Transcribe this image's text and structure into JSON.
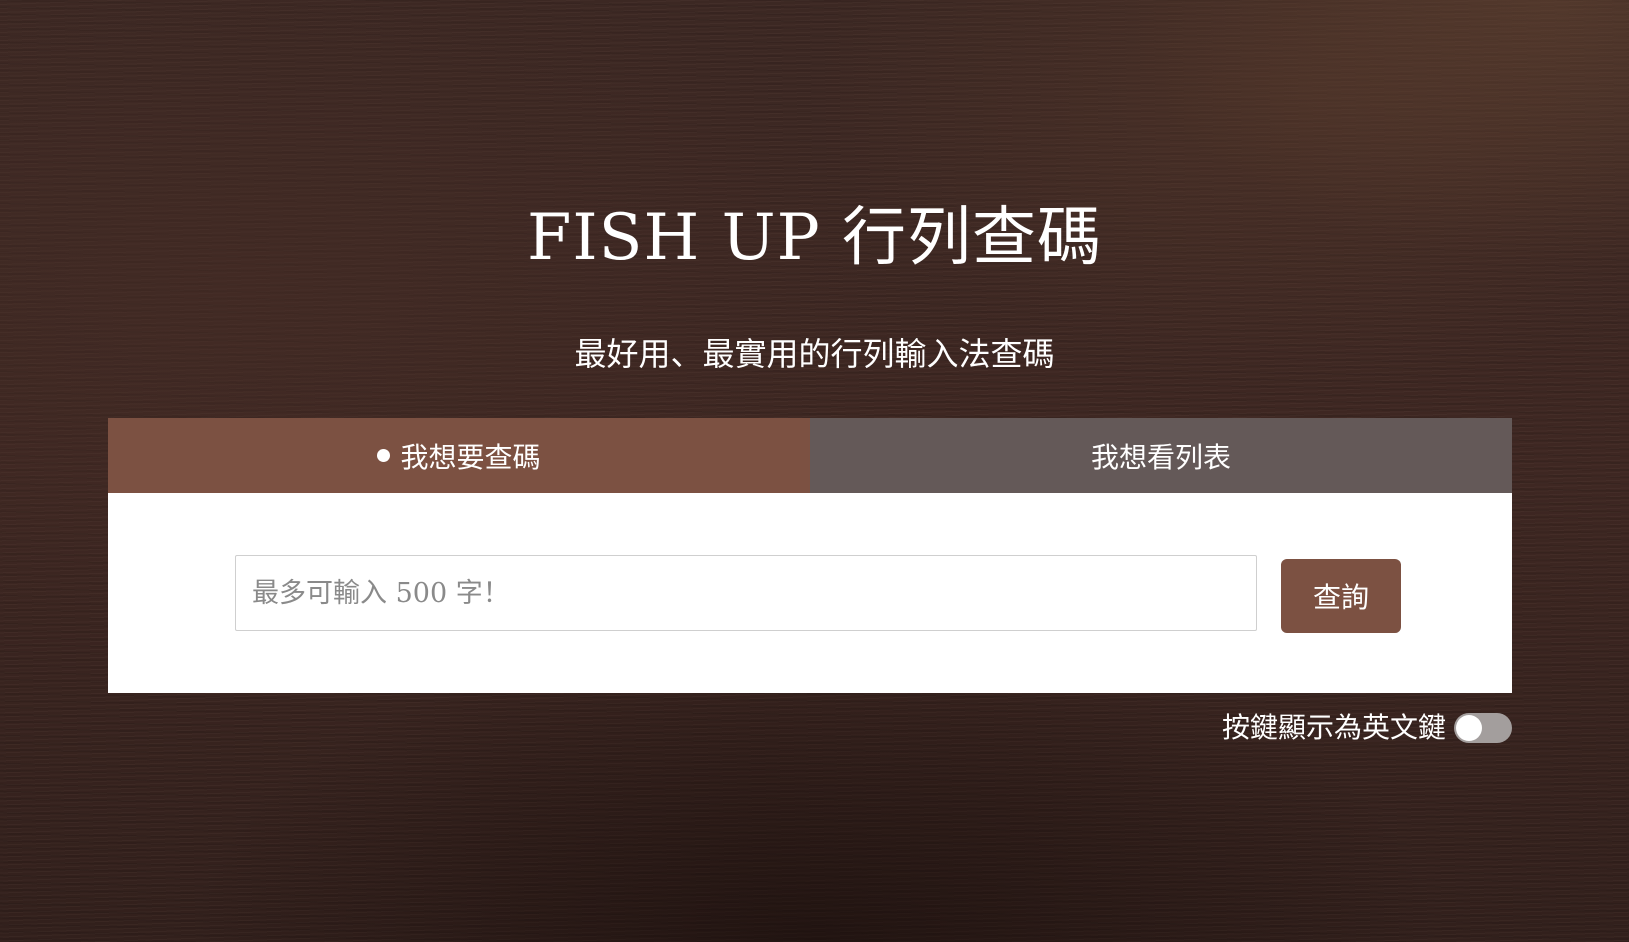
{
  "header": {
    "title": "FISH UP 行列查碼",
    "subtitle": "最好用、最實用的行列輸入法查碼"
  },
  "tabs": [
    {
      "label": "我想要查碼",
      "active": true
    },
    {
      "label": "我想看列表",
      "active": false
    }
  ],
  "search": {
    "placeholder": "最多可輸入 500 字！",
    "value": "",
    "button_label": "查詢"
  },
  "toggle": {
    "label": "按鍵顯示為英文鍵",
    "enabled": false
  },
  "colors": {
    "accent": "#7c5142",
    "tab_inactive": "#645958",
    "background": "#3a2520"
  }
}
